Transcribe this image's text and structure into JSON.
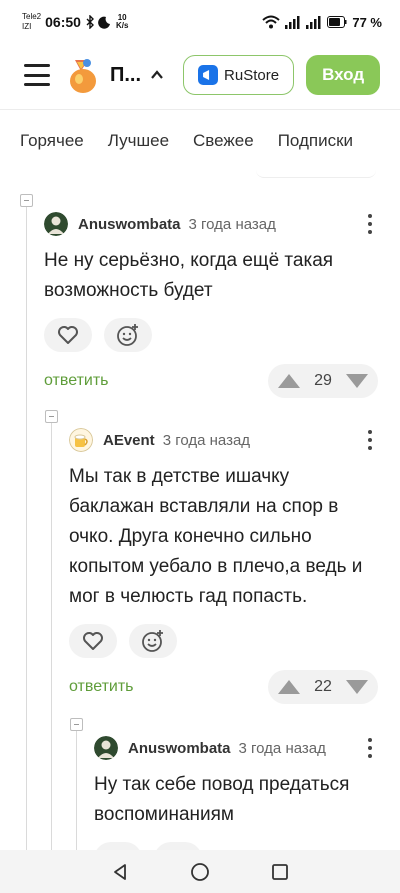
{
  "status_bar": {
    "carrier_1": "Tele2",
    "carrier_2": "IZI",
    "time": "06:50",
    "speed_value": "10",
    "speed_unit": "K/s",
    "battery": "77 %"
  },
  "header": {
    "site_name": "П...",
    "rustore_label": "RuStore",
    "login_label": "Вход"
  },
  "tabs": [
    "Горячее",
    "Лучшее",
    "Свежее",
    "Подписки"
  ],
  "comments": [
    {
      "author": "Anuswombata",
      "time": "3 года назад",
      "text": "Не ну серьёзно, когда ещё такая возможность будет",
      "reply_label": "ответить",
      "score": "29"
    },
    {
      "author": "AEvent",
      "time": "3 года назад",
      "text": "Мы так в детстве ишачку баклажан вставляли на спор в очко. Друга конечно сильно копытом уебало в плечо,а ведь и мог в челюсть гад попасть.",
      "reply_label": "ответить",
      "score": "22"
    },
    {
      "author": "Anuswombata",
      "time": "3 года назад",
      "text": "Ну так себе повод предаться воспоминаниям"
    }
  ],
  "colors": {
    "accent_green": "#8ac858",
    "reply_green": "#5f9d3a",
    "pill_bg": "#f2f2f2"
  },
  "icons": [
    "menu-icon",
    "site-logo",
    "chevron-up-icon",
    "rustore-icon",
    "heart-icon",
    "emoji-add-icon",
    "vote-up-icon",
    "vote-down-icon",
    "more-vert-icon",
    "back-icon",
    "home-icon",
    "recents-icon"
  ]
}
